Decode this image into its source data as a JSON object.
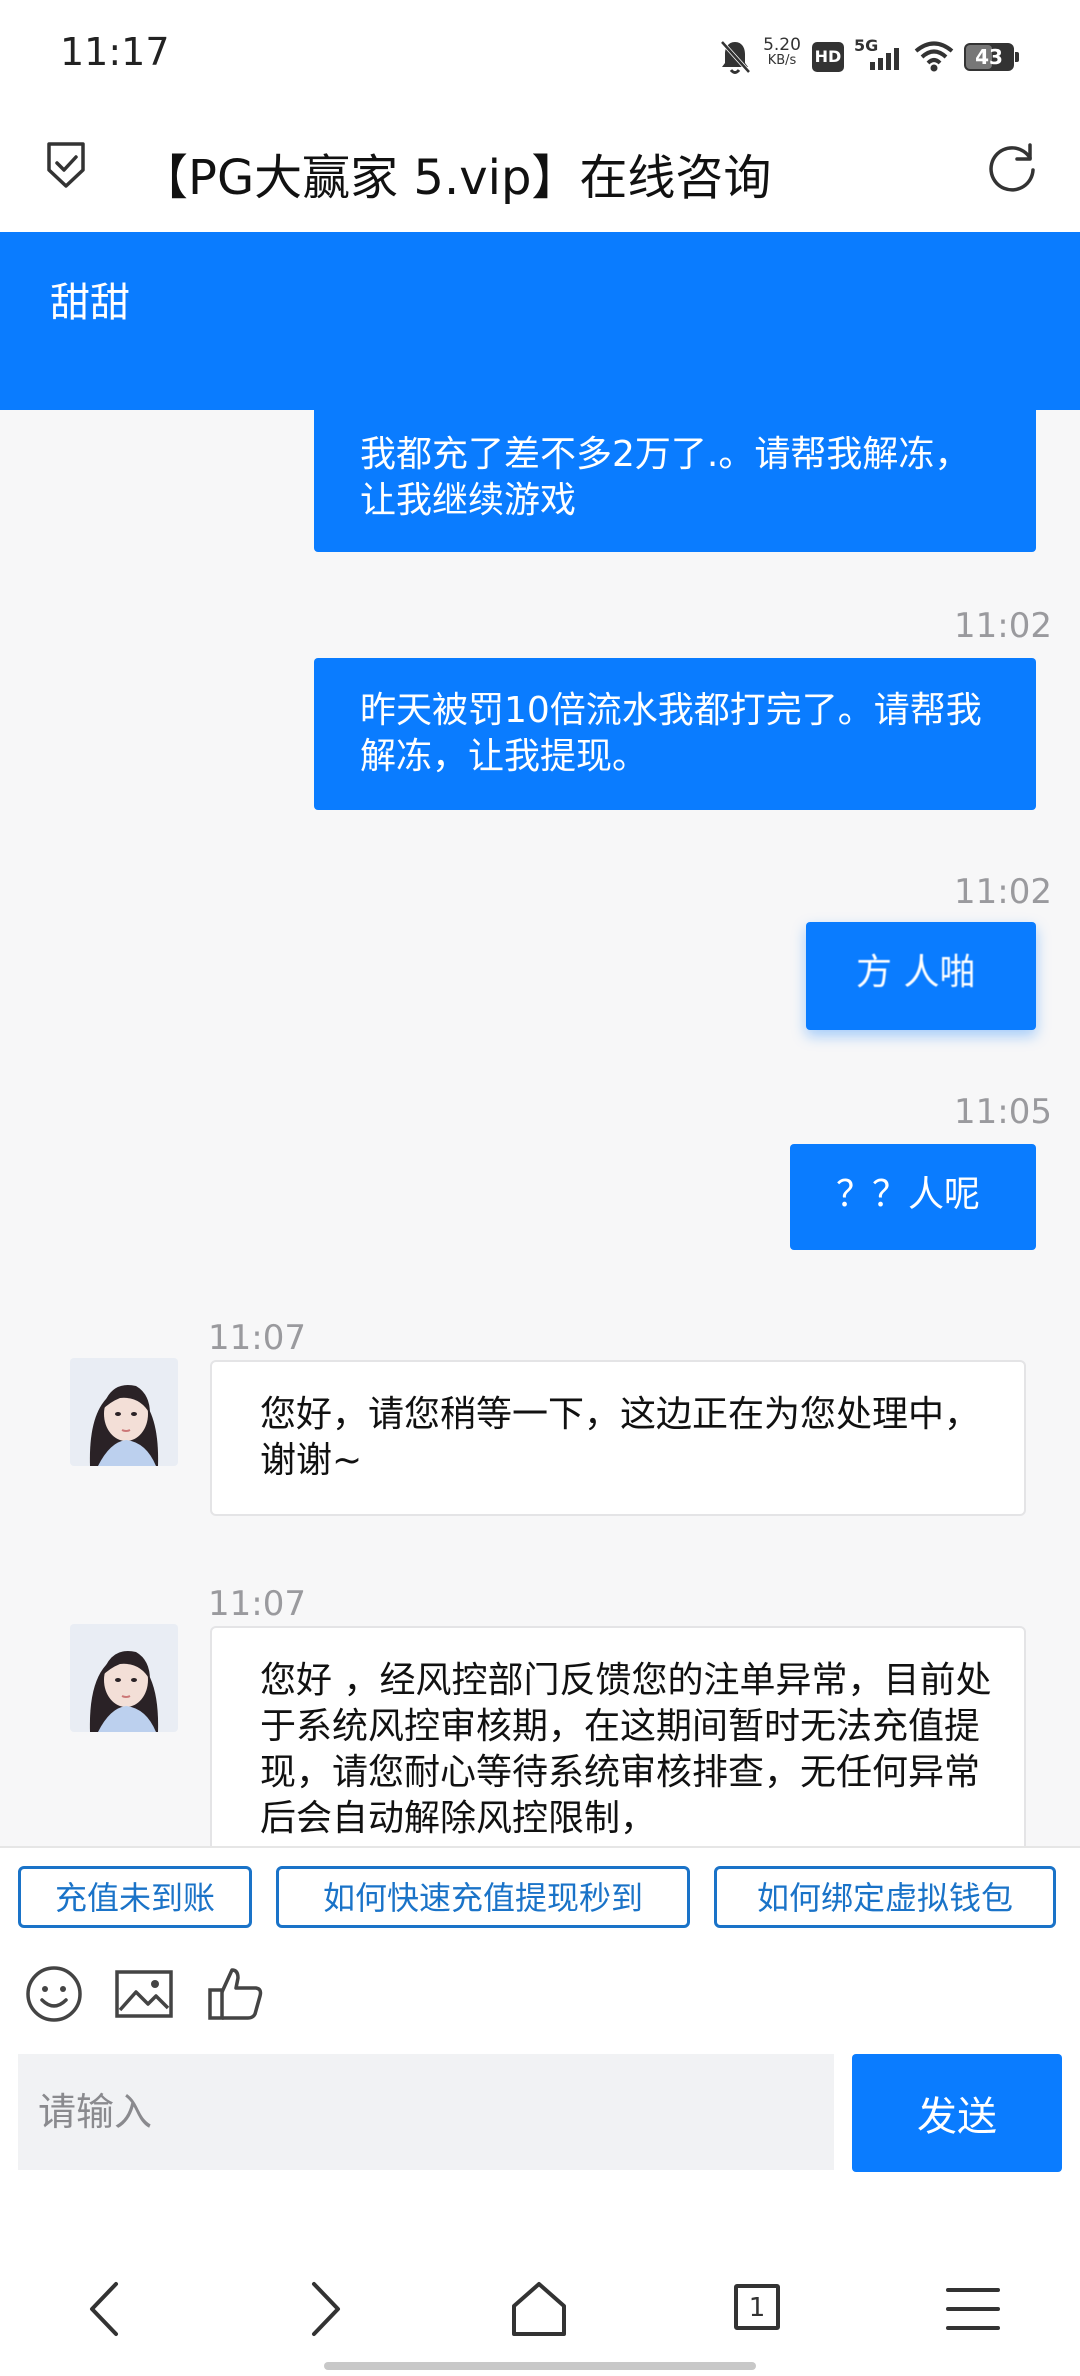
{
  "status_bar": {
    "time": "11:17",
    "net_speed": "5.20",
    "net_speed_unit": "KB/s",
    "hd": "HD",
    "network": "5G",
    "battery": "43"
  },
  "title_bar": {
    "title": "【PG大赢家 5.vip】在线咨询"
  },
  "header": {
    "agent_name": "甜甜"
  },
  "messages": [
    {
      "dir": "out",
      "time": "",
      "text": "我都充了差不多2万了.。请帮我解冻，让我继续游戏"
    },
    {
      "dir": "out",
      "time": "11:02",
      "text": "昨天被罚10倍流水我都打完了。请帮我解冻，让我提现。"
    },
    {
      "dir": "out",
      "time": "11:02",
      "text": "方 人啪"
    },
    {
      "dir": "out",
      "time": "11:05",
      "text": "？？人呢"
    },
    {
      "dir": "in",
      "time": "11:07",
      "text": "您好，请您稍等一下，这边正在为您处理中，谢谢~"
    },
    {
      "dir": "in",
      "time": "11:07",
      "text": "您好 ，经风控部门反馈您的注单异常，目前处于系统风控审核期，在这期间暂时无法充值提现，请您耐心等待系统审核排查，无任何异常后会自动解除风控限制，"
    }
  ],
  "quick_replies": [
    "充值未到账",
    "如何快速充值提现秒到",
    "如何绑定虚拟钱包"
  ],
  "tools": [
    "emoji-icon",
    "image-icon",
    "thumbs-up-icon"
  ],
  "input": {
    "placeholder": "请输入",
    "value": ""
  },
  "send_label": "发送",
  "nav": {
    "tabs_count": "1"
  },
  "colors": {
    "accent": "#0a7cff",
    "quick_border": "#1a73c8"
  }
}
